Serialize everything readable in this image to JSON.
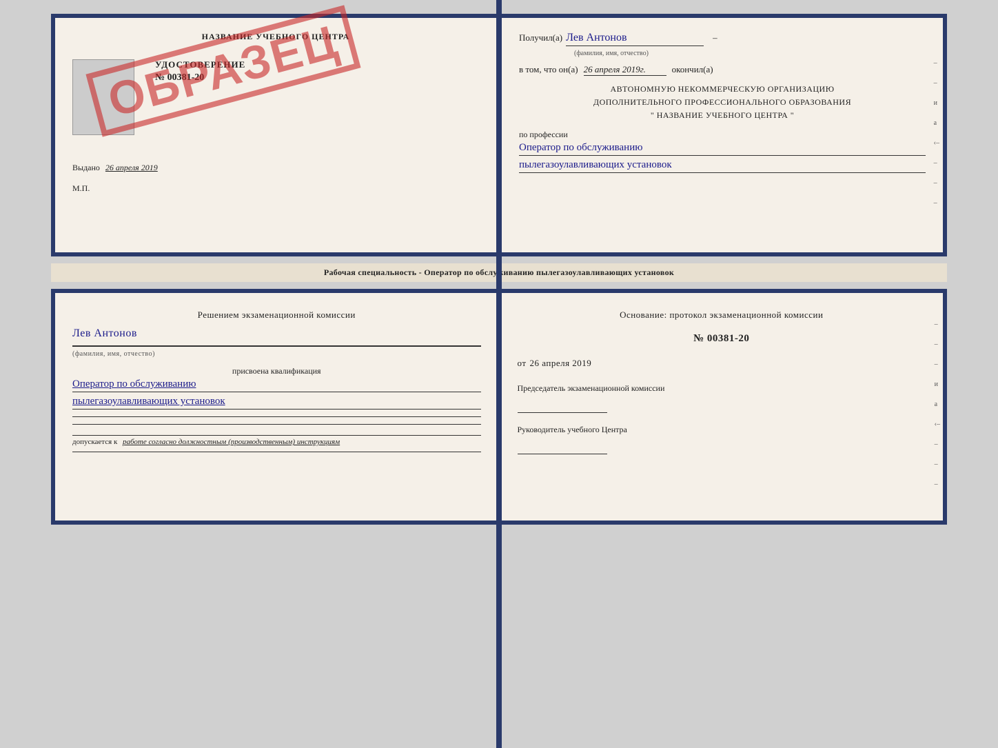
{
  "top_book": {
    "left_page": {
      "title": "НАЗВАНИЕ УЧЕБНОГО ЦЕНТРА",
      "udostoverenie_label": "УДОСТОВЕРЕНИЕ",
      "number": "№ 00381-20",
      "vydano_label": "Выдано",
      "vydano_date": "26 апреля 2019",
      "mp_label": "М.П.",
      "obrazets": "ОБРАЗЕЦ"
    },
    "right_page": {
      "poluchil_label": "Получил(а)",
      "poluchil_name": "Лев Антонов",
      "name_hint": "(фамилия, имя, отчество)",
      "vtom_label": "в том, что он(а)",
      "vtom_date": "26 апреля 2019г.",
      "okonchil_label": "окончил(а)",
      "org_line1": "АВТОНОМНУЮ НЕКОММЕРЧЕСКУЮ ОРГАНИЗАЦИЮ",
      "org_line2": "ДОПОЛНИТЕЛЬНОГО ПРОФЕССИОНАЛЬНОГО ОБРАЗОВАНИЯ",
      "org_line3": "\" НАЗВАНИЕ УЧЕБНОГО ЦЕНТРА \"",
      "po_professii_label": "по профессии",
      "profession_line1": "Оператор по обслуживанию",
      "profession_line2": "пылегазоулавливающих установок",
      "side_marks": [
        "–",
        "–",
        "и",
        "a",
        "‹–",
        "–",
        "–",
        "–"
      ]
    }
  },
  "middle_text": "Рабочая специальность - Оператор по обслуживанию пылегазоулавливающих установок",
  "bottom_book": {
    "left_page": {
      "resheniem_label": "Решением экзаменационной комиссии",
      "name": "Лев Антонов",
      "name_hint": "(фамилия, имя, отчество)",
      "prisvoena_label": "присвоена квалификация",
      "qualification_line1": "Оператор по обслуживанию",
      "qualification_line2": "пылегазоулавливающих установок",
      "dopuskaetsya_label": "допускается к",
      "dopuskaetsya_text": "работе согласно должностным (производственным) инструкциям"
    },
    "right_page": {
      "osnovanie_label": "Основание: протокол экзаменационной комиссии",
      "protocol_number": "№ 00381-20",
      "ot_label": "от",
      "ot_date": "26 апреля 2019",
      "predsedatel_label": "Председатель экзаменационной комиссии",
      "rukovoditel_label": "Руководитель учебного Центра",
      "side_marks": [
        "–",
        "–",
        "–",
        "и",
        "a",
        "‹–",
        "–",
        "–",
        "–"
      ]
    }
  }
}
